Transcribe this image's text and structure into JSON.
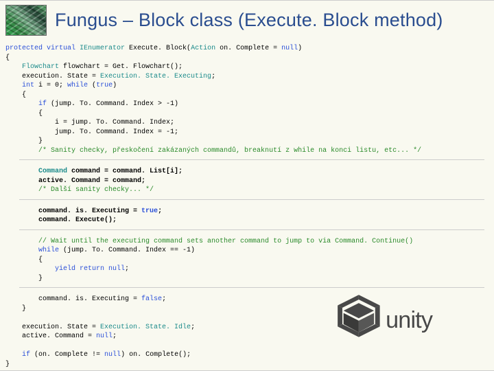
{
  "title": "Fungus – Block class (Execute. Block method)",
  "code": {
    "line1a": "protected virtual ",
    "line1b": "IEnumerator",
    "line1c": " Execute. Block(",
    "line1d": "Action",
    "line1e": " on. Complete = ",
    "line1f": "null",
    "line1g": ")",
    "line2": "{",
    "line3a": "    Flowchart",
    "line3b": " flowchart = Get. Flowchart();",
    "line4a": "    execution. State = ",
    "line4b": "Execution. State. Executing",
    "line4c": ";",
    "line5a": "    int",
    "line5b": " i = 0; ",
    "line5c": "while",
    "line5d": " (",
    "line5e": "true",
    "line5f": ")",
    "line6": "    {",
    "line7a": "        if",
    "line7b": " (jump. To. Command. Index > -1)",
    "line8": "        {",
    "line9": "            i = jump. To. Command. Index;",
    "line10": "            jump. To. Command. Index = -1;",
    "line11": "        }",
    "line12": "        /* Sanity checky, přeskočení zakázaných commandů, breaknutí z while na konci listu, etc... */",
    "line13a": "        Command",
    "line13b": " command = command. List[i];",
    "line14": "        active. Command = command;",
    "line15": "        /* Další sanity checky... */",
    "line16a": "        command. is. Executing = ",
    "line16b": "true",
    "line16c": ";",
    "line17": "        command. Execute();",
    "line18": "        // Wait until the executing command sets another command to jump to via Command. Continue()",
    "line19a": "        while",
    "line19b": " (jump. To. Command. Index == -1)",
    "line20": "        {",
    "line21a": "            yield return null",
    "line21b": ";",
    "line22": "        }",
    "line23a": "        command. is. Executing = ",
    "line23b": "false",
    "line23c": ";",
    "line24": "    }",
    "line25a": "    execution. State = ",
    "line25b": "Execution. State. Idle",
    "line25c": ";",
    "line26a": "    active. Command = ",
    "line26b": "null",
    "line26c": ";",
    "line27a": "    if",
    "line27b": " (on. Complete != ",
    "line27c": "null",
    "line27d": ") on. Complete();",
    "line28": "}"
  },
  "watermark": "unity"
}
